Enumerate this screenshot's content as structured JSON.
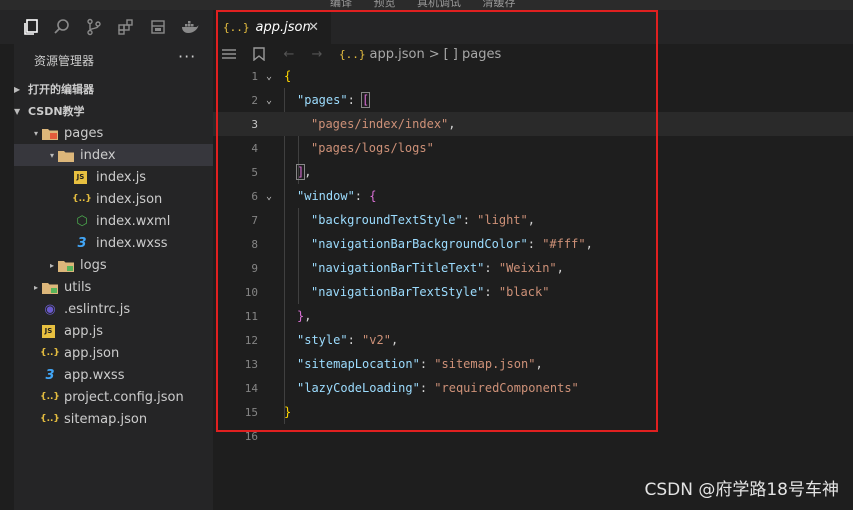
{
  "menu": [
    "编译",
    "预览",
    "真机调试",
    "清缓存"
  ],
  "activity_icons": [
    "files-icon",
    "search-icon",
    "source-control-icon",
    "extensions-icon",
    "debug-icon",
    "docker-icon"
  ],
  "sidebar": {
    "title": "资源管理器",
    "more": "···",
    "sections": [
      {
        "label": "打开的编辑器"
      },
      {
        "label": "CSDN教学"
      }
    ],
    "tree": [
      {
        "label": "pages",
        "depth": 1,
        "icon": "folder-open",
        "twisty": "▾"
      },
      {
        "label": "index",
        "depth": 2,
        "icon": "folder-open",
        "twisty": "▾",
        "selected": true
      },
      {
        "label": "index.js",
        "depth": 3,
        "icon": "js"
      },
      {
        "label": "index.json",
        "depth": 3,
        "icon": "json"
      },
      {
        "label": "index.wxml",
        "depth": 3,
        "icon": "wxml"
      },
      {
        "label": "index.wxss",
        "depth": 3,
        "icon": "wxss"
      },
      {
        "label": "logs",
        "depth": 2,
        "icon": "folder",
        "twisty": "▸"
      },
      {
        "label": "utils",
        "depth": 1,
        "icon": "folder",
        "twisty": "▸"
      },
      {
        "label": ".eslintrc.js",
        "depth": 1,
        "icon": "eslint"
      },
      {
        "label": "app.js",
        "depth": 1,
        "icon": "js"
      },
      {
        "label": "app.json",
        "depth": 1,
        "icon": "json"
      },
      {
        "label": "app.wxss",
        "depth": 1,
        "icon": "wxss"
      },
      {
        "label": "project.config.json",
        "depth": 1,
        "icon": "json"
      },
      {
        "label": "sitemap.json",
        "depth": 1,
        "icon": "json"
      }
    ]
  },
  "editor": {
    "tab": {
      "icon": "{..}",
      "label": "app.json",
      "close": "✕"
    },
    "breadcrumb": {
      "file_icon": "{..}",
      "file": "app.json",
      "sep": ">",
      "symbol": "[ ] pages"
    },
    "current_line": 3,
    "lines": [
      {
        "n": "1",
        "fold": "⌄"
      },
      {
        "n": "2",
        "fold": "⌄"
      },
      {
        "n": "3"
      },
      {
        "n": "4"
      },
      {
        "n": "5"
      },
      {
        "n": "6",
        "fold": "⌄"
      },
      {
        "n": "7"
      },
      {
        "n": "8"
      },
      {
        "n": "9"
      },
      {
        "n": "10"
      },
      {
        "n": "11"
      },
      {
        "n": "12"
      },
      {
        "n": "13"
      },
      {
        "n": "14"
      },
      {
        "n": "15"
      },
      {
        "n": "16"
      }
    ],
    "code": {
      "l1": "{",
      "l2_key": "\"pages\"",
      "l2_colon": ": ",
      "l2_open": "[",
      "l3_val": "\"pages/index/index\"",
      "l3_comma": ",",
      "l4_val": "\"pages/logs/logs\"",
      "l5_close": "]",
      "l5_comma": ",",
      "l6_key": "\"window\"",
      "l6_colon": ": ",
      "l6_open": "{",
      "l7_key": "\"backgroundTextStyle\"",
      "l7_colon": ": ",
      "l7_val": "\"light\"",
      "l7_comma": ",",
      "l8_key": "\"navigationBarBackgroundColor\"",
      "l8_colon": ": ",
      "l8_val": "\"#fff\"",
      "l8_comma": ",",
      "l9_key": "\"navigationBarTitleText\"",
      "l9_colon": ": ",
      "l9_val": "\"Weixin\"",
      "l9_comma": ",",
      "l10_key": "\"navigationBarTextStyle\"",
      "l10_colon": ": ",
      "l10_val": "\"black\"",
      "l11_close": "}",
      "l11_comma": ",",
      "l12_key": "\"style\"",
      "l12_colon": ": ",
      "l12_val": "\"v2\"",
      "l12_comma": ",",
      "l13_key": "\"sitemapLocation\"",
      "l13_colon": ": ",
      "l13_val": "\"sitemap.json\"",
      "l13_comma": ",",
      "l14_key": "\"lazyCodeLoading\"",
      "l14_colon": ": ",
      "l14_val": "\"requiredComponents\"",
      "l15": "}"
    }
  },
  "watermark": "CSDN @府学路18号车神",
  "colors": {
    "highlight_box": "#e02020",
    "key": "#9cdcfe",
    "string": "#ce9178"
  }
}
